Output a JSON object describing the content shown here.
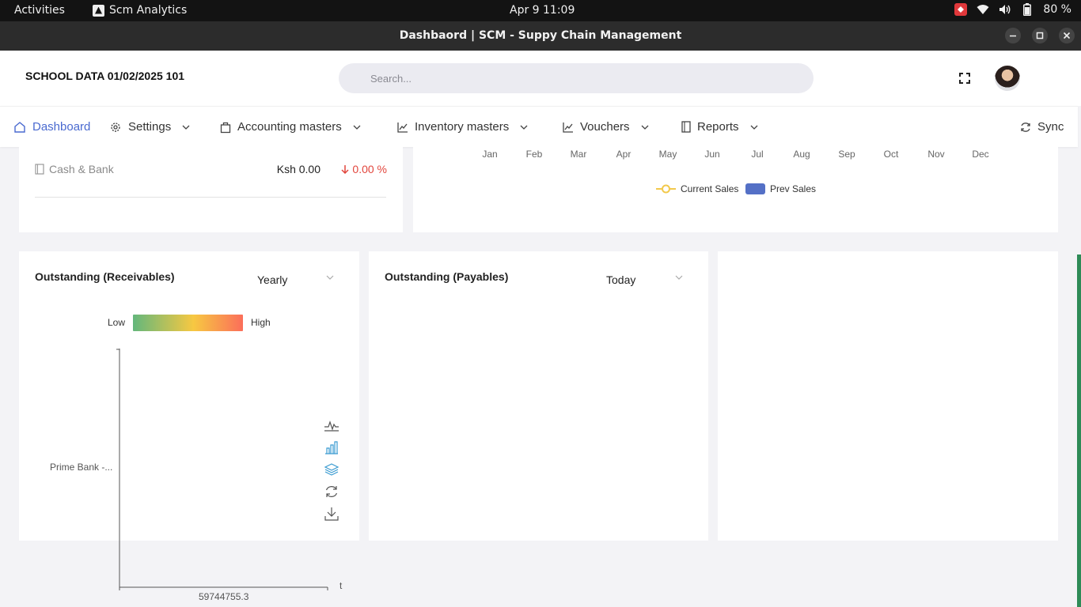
{
  "system_bar": {
    "activities": "Activities",
    "app_name": "Scm Analytics",
    "clock": "Apr 9  11:09",
    "battery": "80 %"
  },
  "window": {
    "title": "Dashbaord | SCM - Suppy Chain Management"
  },
  "header": {
    "company": "SCHOOL DATA 01/02/2025 101",
    "search_placeholder": "Search..."
  },
  "nav": {
    "dashboard": "Dashboard",
    "settings": "Settings",
    "accounting": "Accounting masters",
    "inventory": "Inventory masters",
    "vouchers": "Vouchers",
    "reports": "Reports",
    "sync": "Sync"
  },
  "cash_bank": {
    "label": "Cash & Bank",
    "amount": "Ksh 0.00",
    "change": "0.00 %"
  },
  "sales_chart": {
    "months": [
      "Jan",
      "Feb",
      "Mar",
      "Apr",
      "May",
      "Jun",
      "Jul",
      "Aug",
      "Sep",
      "Oct",
      "Nov",
      "Dec"
    ],
    "legend_current": "Current Sales",
    "legend_prev": "Prev Sales",
    "current_color": "#f2c94c",
    "prev_color": "#5470c6"
  },
  "receivables": {
    "title": "Outstanding (Receivables)",
    "period": "Yearly",
    "scale_low": "Low",
    "scale_high": "High",
    "y_category": "Prime Bank -...",
    "x_value": "59744755.3",
    "x_axis_mark": "t"
  },
  "payables": {
    "title": "Outstanding (Payables)",
    "period": "Today"
  },
  "colors": {
    "accent": "#4a6ad0",
    "negative": "#e2463d",
    "heat_low": "#63b77c",
    "heat_mid": "#f7c842",
    "heat_high": "#fb6e5a"
  }
}
